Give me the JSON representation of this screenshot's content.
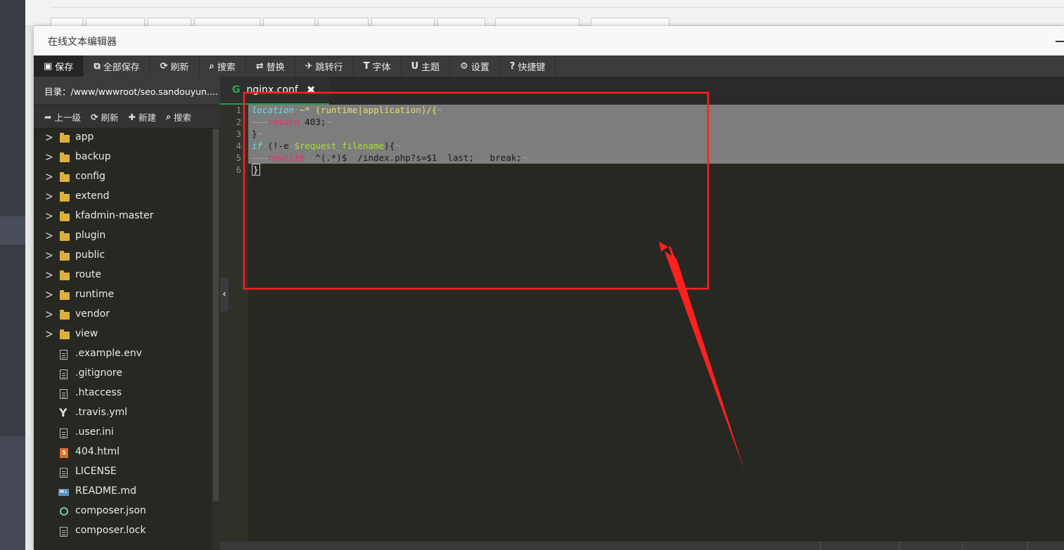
{
  "dialog": {
    "title": "在线文本编辑器"
  },
  "toolbar": {
    "items": [
      {
        "icon": "save-icon",
        "glyph": "▣",
        "label": "保存"
      },
      {
        "icon": "save-all-icon",
        "glyph": "⧉",
        "label": "全部保存"
      },
      {
        "icon": "refresh-icon",
        "glyph": "⟳",
        "label": "刷新"
      },
      {
        "icon": "search-icon",
        "glyph": "⌕",
        "label": "搜索"
      },
      {
        "icon": "replace-icon",
        "glyph": "⇄",
        "label": "替换"
      },
      {
        "icon": "goto-line-icon",
        "glyph": "✈",
        "label": "跳转行"
      },
      {
        "icon": "font-icon",
        "glyph": "T",
        "label": "字体"
      },
      {
        "icon": "theme-icon",
        "glyph": "U",
        "label": "主题"
      },
      {
        "icon": "settings-gear-icon",
        "glyph": "⚙",
        "label": "设置"
      },
      {
        "icon": "help-question-icon",
        "glyph": "?",
        "label": "快捷键"
      }
    ]
  },
  "sidebar": {
    "path": "目录：/www/wwwroot/seo.sandouyun....",
    "actions": [
      {
        "icon": "up-arrow-icon",
        "glyph": "➦",
        "label": "上一级"
      },
      {
        "icon": "refresh-icon",
        "glyph": "⟳",
        "label": "刷新"
      },
      {
        "icon": "plus-icon",
        "glyph": "✚",
        "label": "新建"
      },
      {
        "icon": "search-icon",
        "glyph": "⌕",
        "label": "搜索"
      }
    ],
    "folders": [
      "app",
      "backup",
      "config",
      "extend",
      "kfadmin-master",
      "plugin",
      "public",
      "route",
      "runtime",
      "vendor",
      "view"
    ],
    "files": [
      {
        "name": ".example.env",
        "type": "file"
      },
      {
        "name": ".gitignore",
        "type": "file"
      },
      {
        "name": ".htaccess",
        "type": "file"
      },
      {
        "name": ".travis.yml",
        "type": "yaml"
      },
      {
        "name": ".user.ini",
        "type": "file"
      },
      {
        "name": "404.html",
        "type": "html"
      },
      {
        "name": "LICENSE",
        "type": "file"
      },
      {
        "name": "README.md",
        "type": "markdown"
      },
      {
        "name": "composer.json",
        "type": "json"
      },
      {
        "name": "composer.lock",
        "type": "file"
      }
    ]
  },
  "editor": {
    "tab": {
      "name": "nginx.conf",
      "icon_glyph": "G",
      "close_glyph": "✖"
    },
    "line_numbers": [
      "1",
      "2",
      "3",
      "4",
      "5",
      "6"
    ],
    "code": {
      "l1_kw": "location",
      "l1_rest": "~* (runtime|application)/{",
      "l2_kw": "return",
      "l2_rest": "403;",
      "l3": "}",
      "l4_kw": "if",
      "l4_a": "(!-e",
      "l4_var": "$request_filename",
      "l4_b": "){",
      "l5_kw": "rewrite",
      "l5_rest": "^(.*)$  /index.php?s=$1  last;   break;",
      "l6": "}"
    }
  },
  "colors": {
    "annotation": "#ff2020",
    "tab_accent": "#1e9e44"
  }
}
